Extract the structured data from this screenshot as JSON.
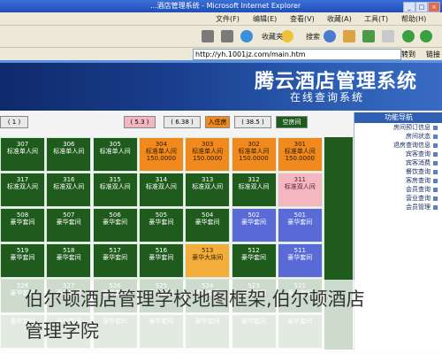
{
  "window": {
    "title": "...酒店管理系统 - Microsoft Internet Explorer",
    "controls": [
      "_",
      "□",
      "×"
    ]
  },
  "menubar": {
    "items": [
      "文件(F)",
      "编辑(E)",
      "查看(V)",
      "收藏(A)",
      "工具(T)",
      "帮助(H)"
    ]
  },
  "toolbar": {
    "search_label": "搜索",
    "favorites_label": "收藏夹"
  },
  "addressbar": {
    "go_label": "转到",
    "url": "http://yh.1001jz.com/main.htm",
    "links_label": "链接"
  },
  "banner": {
    "title": "腾云酒店管理系统",
    "subtitle": "在线查询系统"
  },
  "sidebar": {
    "header": "功能导航",
    "items": [
      "房间预订信息",
      "房间状态",
      "退房查询信息",
      "宾客查询",
      "宾客消费",
      "餐饮查询",
      "客房查询",
      "会员查询",
      "营业查询",
      "会员管理"
    ]
  },
  "status_chips": [
    {
      "label": "( 1 )",
      "color": "#e8e8e8"
    },
    {
      "label": "( 5.3 )",
      "color": "#f4b6bf"
    },
    {
      "label": "( 6.38 )",
      "color": "#e8e8e8"
    },
    {
      "label": "入住房",
      "color": "#f08a1e"
    },
    {
      "label": "( 38.5 )",
      "color": "#e8e8e8"
    },
    {
      "label": "空房间",
      "color": "#1f5b1d"
    }
  ],
  "rooms": [
    {
      "no": "307",
      "type": "标准单人间",
      "price": "",
      "color": "g"
    },
    {
      "no": "306",
      "type": "标准单人间",
      "price": "",
      "color": "g"
    },
    {
      "no": "305",
      "type": "标准单人间",
      "price": "",
      "color": "g"
    },
    {
      "no": "304",
      "type": "标准单人间",
      "price": "150.0000",
      "color": "o"
    },
    {
      "no": "303",
      "type": "标准单人间",
      "price": "150.0000",
      "color": "o"
    },
    {
      "no": "302",
      "type": "标准单人间",
      "price": "150.0000",
      "color": "o"
    },
    {
      "no": "301",
      "type": "标准单人间",
      "price": "150.0000",
      "color": "o"
    },
    {
      "no": "317",
      "type": "标准双人间",
      "price": "",
      "color": "g"
    },
    {
      "no": "316",
      "type": "标准双人间",
      "price": "",
      "color": "g"
    },
    {
      "no": "315",
      "type": "标准双人间",
      "price": "",
      "color": "g"
    },
    {
      "no": "314",
      "type": "标准双人间",
      "price": "",
      "color": "g"
    },
    {
      "no": "313",
      "type": "标准双人间",
      "price": "",
      "color": "g"
    },
    {
      "no": "312",
      "type": "标准双人间",
      "price": "",
      "color": "g"
    },
    {
      "no": "311",
      "type": "标准双人间",
      "price": "",
      "color": "p"
    },
    {
      "no": "508",
      "type": "豪华套间",
      "price": "",
      "color": "g"
    },
    {
      "no": "507",
      "type": "豪华套间",
      "price": "",
      "color": "g"
    },
    {
      "no": "506",
      "type": "豪华套间",
      "price": "",
      "color": "g"
    },
    {
      "no": "505",
      "type": "豪华套间",
      "price": "",
      "color": "g"
    },
    {
      "no": "504",
      "type": "豪华套间",
      "price": "",
      "color": "g"
    },
    {
      "no": "502",
      "type": "豪华套间",
      "price": "",
      "color": "b"
    },
    {
      "no": "501",
      "type": "豪华套间",
      "price": "",
      "color": "b"
    },
    {
      "no": "519",
      "type": "豪华套间",
      "price": "",
      "color": "g"
    },
    {
      "no": "518",
      "type": "豪华套间",
      "price": "",
      "color": "g"
    },
    {
      "no": "517",
      "type": "豪华套间",
      "price": "",
      "color": "g"
    },
    {
      "no": "516",
      "type": "豪华套间",
      "price": "",
      "color": "g"
    },
    {
      "no": "513",
      "type": "豪华大床间",
      "price": "",
      "color": "y"
    },
    {
      "no": "512",
      "type": "豪华套间",
      "price": "",
      "color": "g"
    },
    {
      "no": "511",
      "type": "豪华套间",
      "price": "",
      "color": "b"
    },
    {
      "no": "528",
      "type": "豪华套间",
      "price": "",
      "color": "g"
    },
    {
      "no": "527",
      "type": "豪华套间",
      "price": "",
      "color": "g"
    },
    {
      "no": "526",
      "type": "豪华套间",
      "price": "",
      "color": "g"
    },
    {
      "no": "525",
      "type": "豪华套间",
      "price": "",
      "color": "g"
    },
    {
      "no": "524",
      "type": "豪华套间",
      "price": "",
      "color": "g"
    },
    {
      "no": "523",
      "type": "豪华套间",
      "price": "",
      "color": "g"
    },
    {
      "no": "521",
      "type": "豪华套间",
      "price": "",
      "color": "g"
    },
    {
      "no": "",
      "type": "豪华套间",
      "price": "",
      "color": "g"
    },
    {
      "no": "",
      "type": "豪华套间",
      "price": "",
      "color": "g"
    },
    {
      "no": "",
      "type": "豪华套间",
      "price": "",
      "color": "g"
    },
    {
      "no": "",
      "type": "豪华套间",
      "price": "",
      "color": "g"
    },
    {
      "no": "",
      "type": "豪华套间",
      "price": "",
      "color": "g"
    },
    {
      "no": "",
      "type": "豪华套间",
      "price": "",
      "color": "g"
    },
    {
      "no": "",
      "type": "豪华套间",
      "price": "",
      "color": "g"
    }
  ],
  "watermark": {
    "line1": "伯尔顿酒店管理学校地图框架,伯尔顿酒店",
    "line2": "管理学院"
  }
}
